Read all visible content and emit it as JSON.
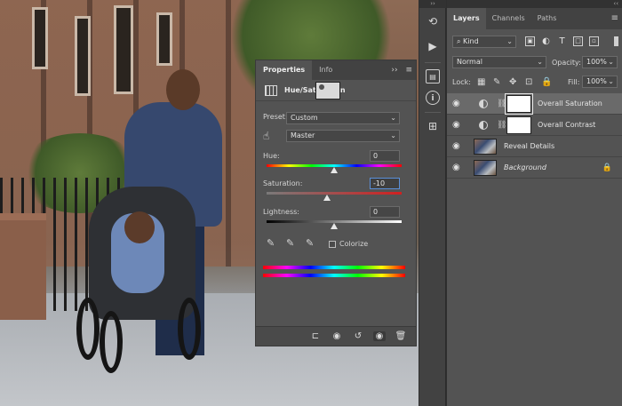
{
  "properties": {
    "tabs": [
      "Properties",
      "Info"
    ],
    "panel_controls": "››",
    "title": "Hue/Saturation",
    "preset_label": "Preset:",
    "preset_value": "Custom",
    "channel_value": "Master",
    "hue_label": "Hue:",
    "hue_value": "0",
    "hue_level": 0.5,
    "saturation_label": "Saturation:",
    "saturation_value": "-10",
    "saturation_level": 0.45,
    "lightness_label": "Lightness:",
    "lightness_value": "0",
    "lightness_level": 0.5,
    "colorize_label": "Colorize"
  },
  "layers_panel": {
    "top_controls": "‹‹",
    "tabs": [
      "Layers",
      "Channels",
      "Paths"
    ],
    "menu": "≡",
    "filter_value": "Kind",
    "blend_mode": "Normal",
    "opacity_label": "Opacity:",
    "opacity_value": "100%",
    "lock_label": "Lock:",
    "fill_label": "Fill:",
    "fill_value": "100%",
    "layers": [
      {
        "name": "Overall Saturation",
        "type": "adjustment",
        "selected": true
      },
      {
        "name": "Overall Contrast",
        "type": "adjustment",
        "selected": false
      },
      {
        "name": "Reveal Details",
        "type": "image",
        "selected": false
      },
      {
        "name": "Background",
        "type": "background",
        "selected": false
      }
    ]
  },
  "strip": {
    "top_controls": "››"
  },
  "colors": {
    "panel_bg": "#535353",
    "tab_bg": "#424242",
    "focus_blue": "#5a8fd8"
  }
}
